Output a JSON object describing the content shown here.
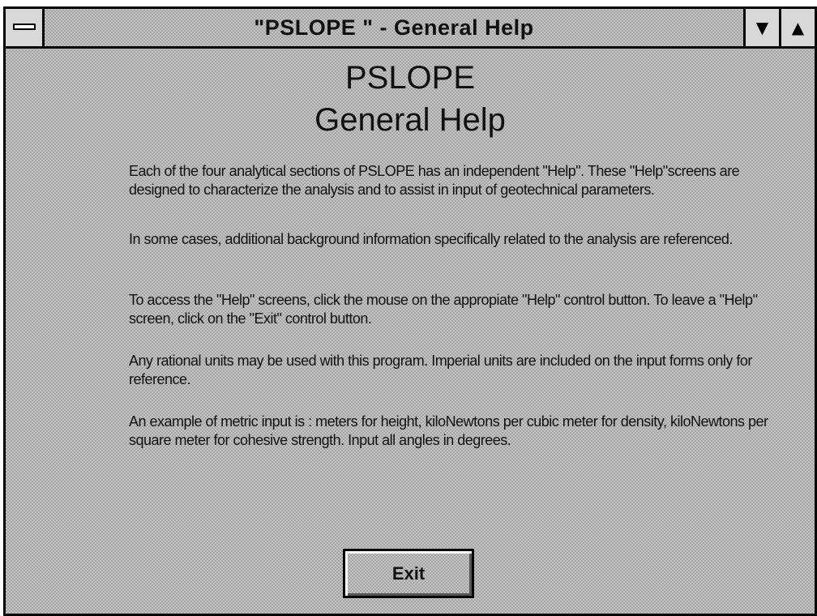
{
  "window": {
    "title": "\"PSLOPE \" - General Help",
    "system_menu_icon": "system-menu-icon",
    "minimize_icon": "minimize-arrow-icon",
    "maximize_icon": "maximize-arrow-icon"
  },
  "content": {
    "heading_line1": "PSLOPE",
    "heading_line2": "General Help",
    "paragraphs": [
      "Each of the four analytical sections of PSLOPE has an independent \"Help\". These \"Help\"screens are designed to characterize the analysis and to assist in input of geotechnical parameters.",
      "In some cases, additional background information specifically related to the analysis are referenced.",
      "To access the \"Help\" screens, click the mouse on the appropiate \"Help\" control button. To leave a \"Help\" screen, click on the \"Exit\" control button.",
      "Any rational units may be used with this program. Imperial units are included on the input forms only for reference.",
      "An example of metric input is : meters for height, kiloNewtons per cubic meter for density, kiloNewtons per square meter for cohesive strength. Input all angles in degrees."
    ]
  },
  "buttons": {
    "exit_label": "Exit"
  }
}
